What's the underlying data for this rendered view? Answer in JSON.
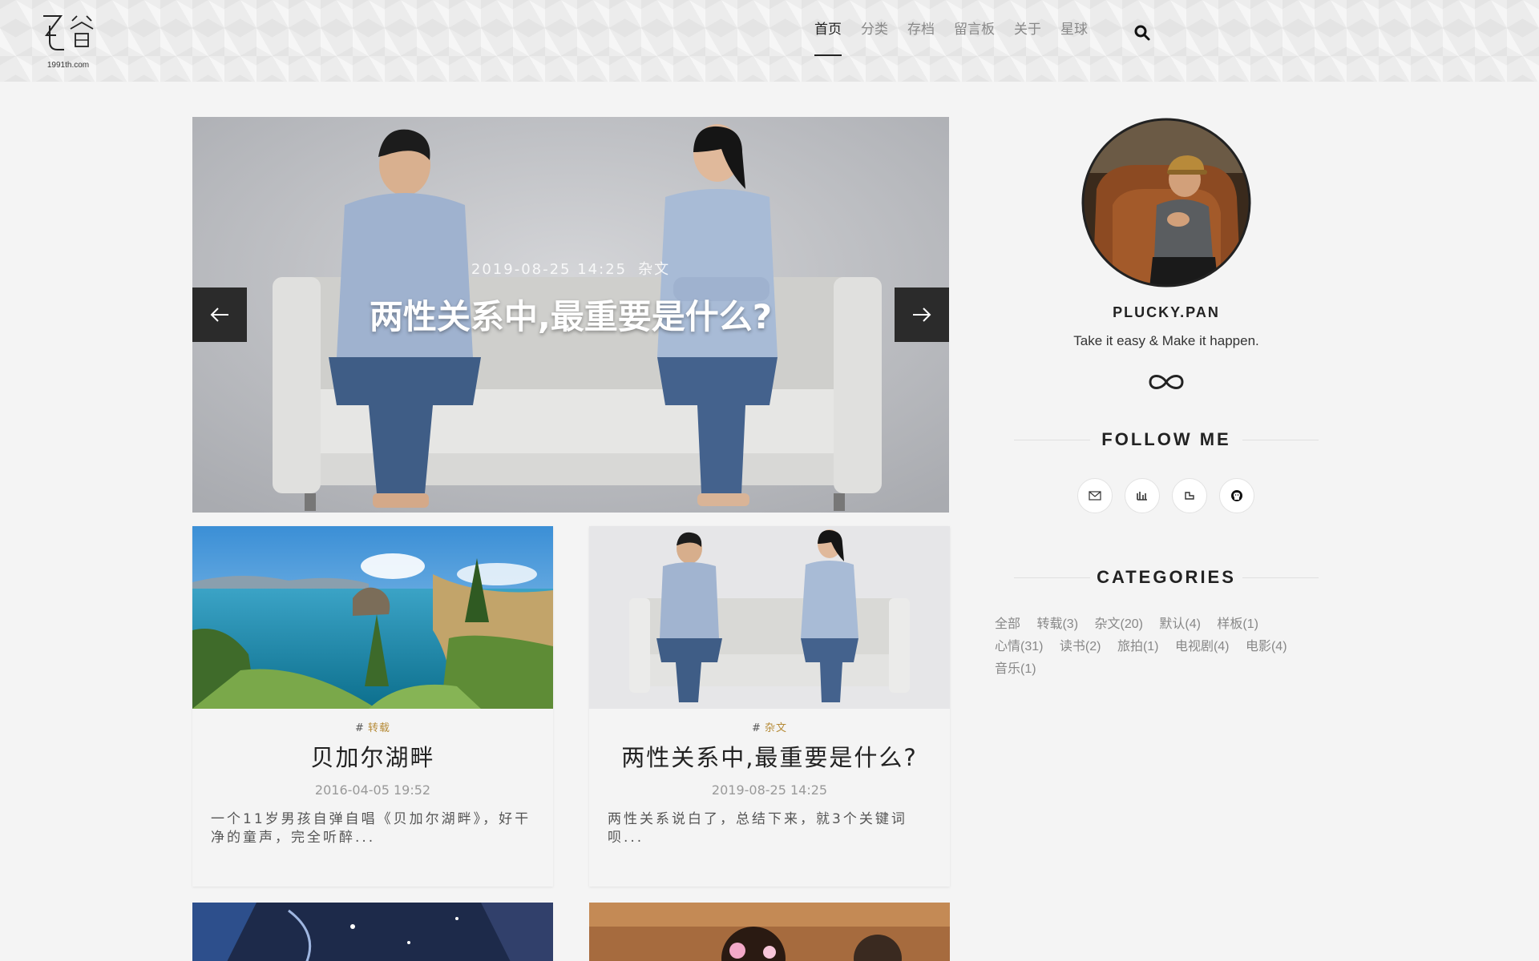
{
  "header": {
    "logo_domain": "1991th.com",
    "nav": [
      "首页",
      "分类",
      "存档",
      "留言板",
      "关于",
      "星球"
    ],
    "active_nav": "首页",
    "search_icon": "search-icon"
  },
  "slider": {
    "date": "2019-08-25 14:25",
    "category": "杂文",
    "title": "两性关系中,最重要是什么?",
    "prev_icon": "arrow-left-icon",
    "next_icon": "arrow-right-icon"
  },
  "posts": [
    {
      "tag": "转载",
      "title": "贝加尔湖畔",
      "date": "2016-04-05 19:52",
      "excerpt": "一个11岁男孩自弹自唱《贝加尔湖畔》，好干净的童声，完全听醉..."
    },
    {
      "tag": "杂文",
      "title": "两性关系中,最重要是什么?",
      "date": "2019-08-25 14:25",
      "excerpt": "两性关系说白了，总结下来，就3个关键词呗..."
    }
  ],
  "sidebar": {
    "author_name": "PLUCKY.PAN",
    "motto": "Take it easy & Make it happen.",
    "follow_title": "FOLLOW ME",
    "social_icons": [
      "mail-icon",
      "music-icon",
      "bookmark-icon",
      "github-icon"
    ],
    "categories_title": "CATEGORIES",
    "categories": [
      "全部",
      "转载(3)",
      "杂文(20)",
      "默认(4)",
      "样板(1)",
      "心情(31)",
      "读书(2)",
      "旅拍(1)",
      "电视剧(4)",
      "电影(4)",
      "音乐(1)"
    ]
  },
  "colors": {
    "accent_tag": "#b58a36",
    "background": "#f4f4f4",
    "header_bg": "#ececec"
  }
}
